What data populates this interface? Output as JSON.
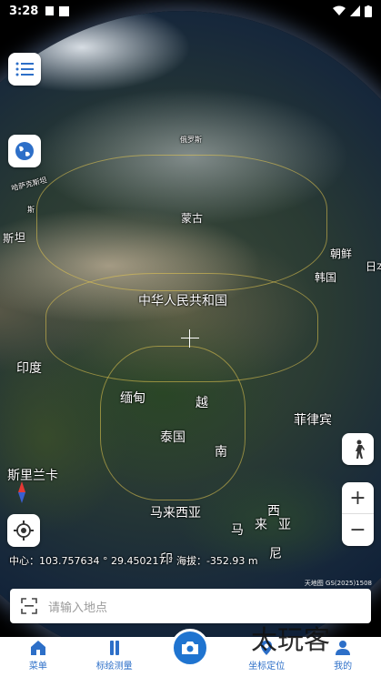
{
  "status": {
    "time": "3:28"
  },
  "map": {
    "labels": {
      "russia": "俄罗斯",
      "kazakhstan": "哈萨克斯坦",
      "mongolia": "蒙古",
      "north_korea": "朝鲜",
      "south_korea": "韩国",
      "japan": "日本",
      "china": "中华人民共和国",
      "india": "印度",
      "myanmar": "缅甸",
      "vietnam": "越",
      "thailand": "泰国",
      "cambodia": "南",
      "philippines": "菲律宾",
      "sri_lanka": "斯里兰卡",
      "malaysia_w": "马来西亚",
      "malaysia_e1": "西",
      "malaysia_e2": "马",
      "malaysia_e3": "来",
      "malaysia_e4": "亚",
      "indonesia1": "印",
      "indonesia2": "尼",
      "pakistan_partial": "坦",
      "afghan_partial": "斯",
      "kyrgyz_partial": "斯"
    },
    "coordinates_text": "中心：103.757634 ° 29.450217 ° 海拔：-352.93 m",
    "attribution": "天地图 GS(2025)1508"
  },
  "controls": {
    "menu_icon": "list-icon",
    "layers_icon": "globe-icon",
    "locate_icon": "target-icon",
    "walk_icon": "walking-person-icon",
    "zoom_in": "+",
    "zoom_out": "−"
  },
  "search": {
    "placeholder": "请输入地点"
  },
  "tabs": [
    {
      "label": "菜单",
      "icon": "home-icon"
    },
    {
      "label": "标绘测量",
      "icon": "ruler-icon"
    },
    {
      "label": "",
      "icon": "camera-icon"
    },
    {
      "label": "坐标定位",
      "icon": "location-icon"
    },
    {
      "label": "我的",
      "icon": "user-icon"
    }
  ],
  "watermark": "太玩客",
  "colors": {
    "accent": "#1f74d0",
    "tab_text": "#2d6fc8"
  }
}
